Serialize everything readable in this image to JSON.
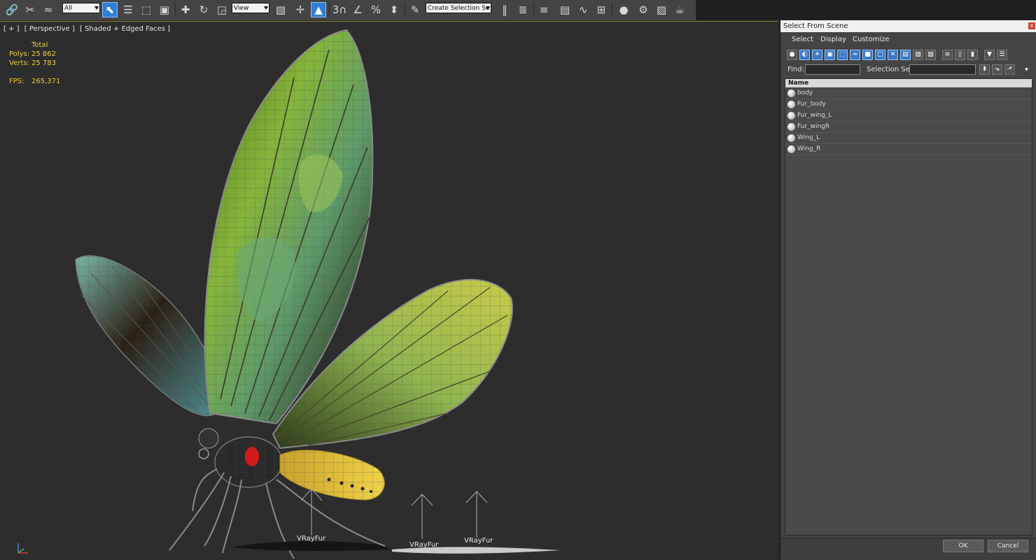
{
  "toolbar": {
    "filter_value": "All",
    "coord_value": "View",
    "selection_set_placeholder": "Create Selection Se",
    "snap_labels": {
      "snap": "3",
      "percent": "%"
    }
  },
  "viewport": {
    "labels": [
      "[ + ]",
      "[ Perspective ]",
      "[ Shaded + Edged Faces ]"
    ],
    "stats": {
      "header": "Total",
      "polys_label": "Polys:",
      "polys_value": "25 862",
      "verts_label": "Verts:",
      "verts_value": "25 783",
      "fps_label": "FPS:",
      "fps_value": "265,371"
    },
    "helpers": [
      "VRayFur",
      "VRayFur",
      "VRayFur"
    ]
  },
  "dialog": {
    "title": "Select From Scene",
    "close": "x",
    "menu": [
      "Select",
      "Display",
      "Customize"
    ],
    "find_label": "Find:",
    "selection_set_label": "Selection Set:",
    "column_header": "Name",
    "items": [
      "body",
      "Fur_body",
      "Fur_wing_L",
      "Fur_wingR",
      "Wing_L",
      "Wing_R"
    ],
    "ok_label": "OK",
    "cancel_label": "Cancel"
  },
  "colors": {
    "accent": "#2f7fd3",
    "stats_text": "#e8cf3a",
    "viewport_bg": "#2d2d2d"
  }
}
